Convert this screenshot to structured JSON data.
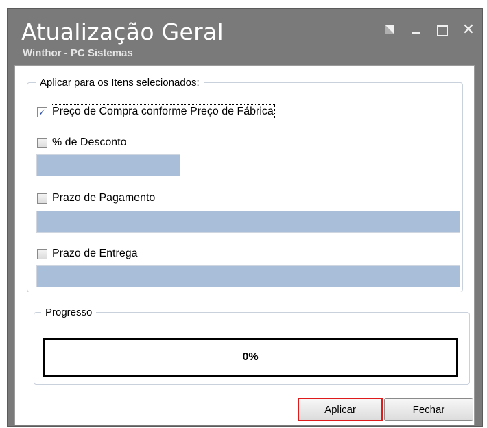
{
  "window": {
    "title": "Atualização Geral",
    "subtitle": "Winthor - PC Sistemas",
    "controls": {
      "restore_icon": "restore-icon",
      "minimize_icon": "minimize-icon",
      "maximize_icon": "maximize-icon",
      "close_glyph": "✕"
    }
  },
  "selected_items_group": {
    "label": "Aplicar para os Itens selecionados:",
    "options": [
      {
        "label": "Preço de Compra conforme Preço de Fábrica",
        "checked": true
      },
      {
        "label": "% de Desconto",
        "checked": false,
        "value": ""
      },
      {
        "label": "Prazo de Pagamento",
        "checked": false,
        "value": ""
      },
      {
        "label": "Prazo de Entrega",
        "checked": false,
        "value": ""
      }
    ]
  },
  "progress_group": {
    "label": "Progresso",
    "value_text": "0%",
    "value_percent": 0
  },
  "buttons": {
    "apply_prefix": "Ap",
    "apply_underlined": "l",
    "apply_suffix": "icar",
    "close_underlined": "F",
    "close_suffix": "echar"
  },
  "colors": {
    "window_frame": "#7a7a7a",
    "field_fill": "#a9bfd9",
    "highlight": "#e01b1b",
    "checkmark": "#2a4ea8"
  }
}
